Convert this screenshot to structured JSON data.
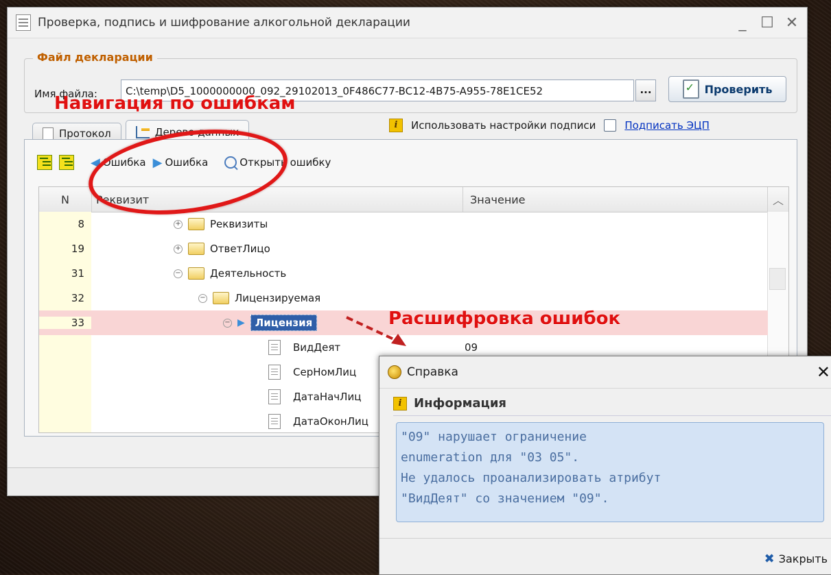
{
  "window": {
    "title": "Проверка, подпись и шифрование алкогольной декларации",
    "minimize": "_",
    "maximize": "☐",
    "close": "✕"
  },
  "file_group": {
    "title": "Файл декларации",
    "name_label": "Имя файла:",
    "name_value": "C:\\temp\\D5_1000000000_092_29102013_0F486C77-BC12-4B75-A955-78E1CE52",
    "browse_label": "...",
    "check_label": "Проверить"
  },
  "annotations": {
    "navigation": "Навигация по ошибкам",
    "decoding": "Расшифровка ошибок"
  },
  "tabs": [
    {
      "label": "Протокол"
    },
    {
      "label": "Дерево данных"
    }
  ],
  "signing": {
    "use_settings_label": "Использовать настройки подписи",
    "use_settings_checked": false,
    "sign_link": "Подписать ЭЦП"
  },
  "toolbar": {
    "prev_error": "Ошибка",
    "next_error": "Ошибка",
    "open_error": "Открыть ошибку"
  },
  "grid": {
    "col_n": "N",
    "col_attr": "Реквизит",
    "col_value": "Значение",
    "rows": [
      {
        "n": "8",
        "name": "Реквизиты",
        "value": ""
      },
      {
        "n": "19",
        "name": "ОтветЛицо",
        "value": ""
      },
      {
        "n": "31",
        "name": "Деятельность",
        "value": ""
      },
      {
        "n": "32",
        "name": "Лицензируемая",
        "value": ""
      },
      {
        "n": "33",
        "name": "Лицензия",
        "value": ""
      },
      {
        "n": "",
        "name": "ВидДеят",
        "value": "09"
      },
      {
        "n": "",
        "name": "СерНомЛиц",
        "value": ""
      },
      {
        "n": "",
        "name": "ДатаНачЛиц",
        "value": ""
      },
      {
        "n": "",
        "name": "ДатаОконЛиц",
        "value": ""
      }
    ]
  },
  "dialog": {
    "title": "Справка",
    "heading": "Информация",
    "message_lines": [
      "\"09\" нарушает ограничение",
      "enumeration для \"03 05\".",
      "Не удалось проанализировать атрибут",
      "\"ВидДеят\" со значением \"09\"."
    ],
    "close_label": "Закрыть",
    "close_x": "✕"
  },
  "colors": {
    "annotation_red": "#e01010",
    "error_row": "#f9d5d5",
    "selected_node": "#2f5ea8",
    "message_bg": "#d4e3f5"
  }
}
